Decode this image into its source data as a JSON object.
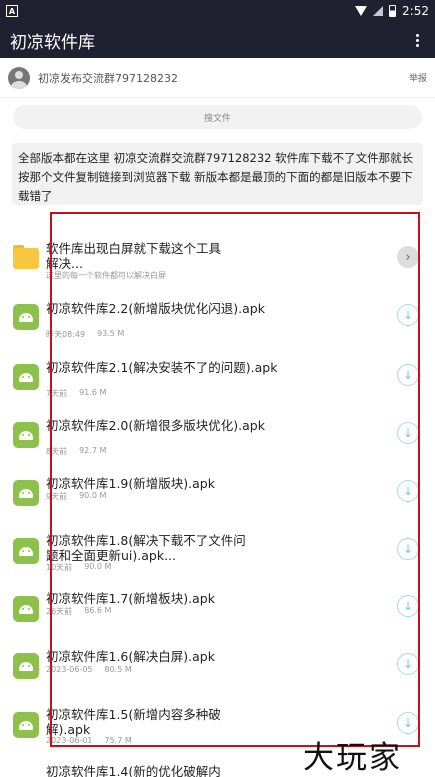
{
  "status": {
    "left_badge": "A",
    "time": "2:52"
  },
  "toolbar": {
    "title": "初凉软件库"
  },
  "group": {
    "text": "初凉发布交流群797128232",
    "report_label": "举报"
  },
  "search": {
    "placeholder": "搜文件"
  },
  "notice": {
    "text": "全部版本都在这里 初凉交流群交流群797128232 软件库下载不了文件那就长按那个文件复制链接到浏览器下载 新版本都是最顶的下面的都是旧版本不要下载错了"
  },
  "items": [
    {
      "name": "软件库出现白屏就下载这个工具解决...",
      "sub": "这里的每一个软件都可以解决白屏",
      "type": "folder"
    },
    {
      "name": "初凉软件库2.2(新增版块优化闪退).apk",
      "date": "昨天08:49",
      "size": "93.5 M",
      "type": "apk"
    },
    {
      "name": "初凉软件库2.1(解决安装不了的问题).apk",
      "date": "7天前",
      "size": "91.6 M",
      "type": "apk"
    },
    {
      "name": "初凉软件库2.0(新增很多版块优化).apk",
      "date": "8天前",
      "size": "92.7 M",
      "type": "apk"
    },
    {
      "name": "初凉软件库1.9(新增版块).apk",
      "date": "9天前",
      "size": "90.0 M",
      "type": "apk"
    },
    {
      "name": "初凉软件库1.8(解决下载不了文件问题和全面更新ui).apk...",
      "date": "10天前",
      "size": "90.0 M",
      "type": "apk"
    },
    {
      "name": "初凉软件库1.7(新增板块).apk",
      "date": "26天前",
      "size": "86.6 M",
      "type": "apk"
    },
    {
      "name": "初凉软件库1.6(解决白屏).apk",
      "date": "2023-06-05",
      "size": "80.5 M",
      "type": "apk"
    },
    {
      "name": "初凉软件库1.5(新增内容多种破解).apk",
      "date": "2023-06-01",
      "size": "75.7 M",
      "type": "apk"
    },
    {
      "name": "初凉软件库1.4(新的优化破解内",
      "date": "",
      "size": "",
      "type": "apk"
    }
  ],
  "watermark": "大玩家"
}
